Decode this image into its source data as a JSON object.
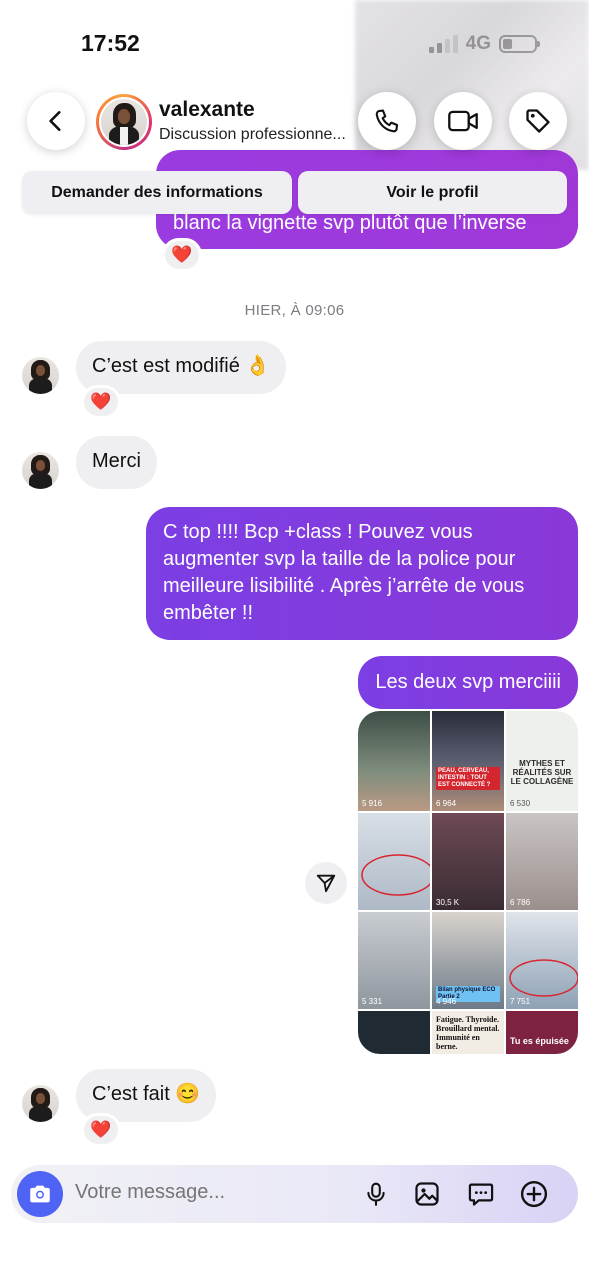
{
  "status_bar": {
    "time": "17:52",
    "network": "4G"
  },
  "header": {
    "username": "valexante",
    "subtitle": "Discussion professionne...",
    "icons": {
      "back": "chevron-left-icon",
      "call": "phone-icon",
      "video": "video-icon",
      "tag": "tag-icon"
    }
  },
  "quick_actions": {
    "info_label": "Demander des informations",
    "profile_label": "Voir le profil"
  },
  "messages": {
    "top_partial": "blanc la vignette svp plutôt que l’inverse",
    "date_separator": "HIER, À 09:06",
    "m1": "C’est est modifié 👌",
    "m2": "Merci",
    "m3": "C top !!!! Bcp +class ! Pouvez vous augmenter svp la taille de la police pour meilleure lisibilité . Après j’arrête de vous embêter !!",
    "m4": "Les deux svp merciiii",
    "m5": "C’est fait 😊",
    "reaction": "❤️"
  },
  "shared_post": {
    "tiles": [
      {
        "caption": "",
        "views": "5 916"
      },
      {
        "caption": "PEAU, CERVEAU, INTESTIN : TOUT EST CONNECTÉ ?",
        "views": "6 964"
      },
      {
        "caption": "MYTHES ET RÉALITÉS SUR LE COLLAGÈNE",
        "views": "6 530"
      },
      {
        "caption": "",
        "views": ""
      },
      {
        "caption": "",
        "views": "30,5 K"
      },
      {
        "caption": "",
        "views": "6 786"
      },
      {
        "caption": "",
        "views": "5 331"
      },
      {
        "caption": "Bilan physique ECO Partie 2",
        "views": "4 946"
      },
      {
        "caption": "",
        "views": "7 751"
      },
      {
        "caption": "",
        "views": ""
      },
      {
        "caption": "Fatigue. Thyroïde. Brouillard mental. Immunité en berne.",
        "views": ""
      },
      {
        "caption": "Tu es épuisée",
        "views": ""
      }
    ]
  },
  "composer": {
    "placeholder": "Votre message..."
  },
  "colors": {
    "outgoing_bubble": "#7b3fe4",
    "incoming_bubble": "#efeff2",
    "camera_button": "#4f63f5"
  }
}
